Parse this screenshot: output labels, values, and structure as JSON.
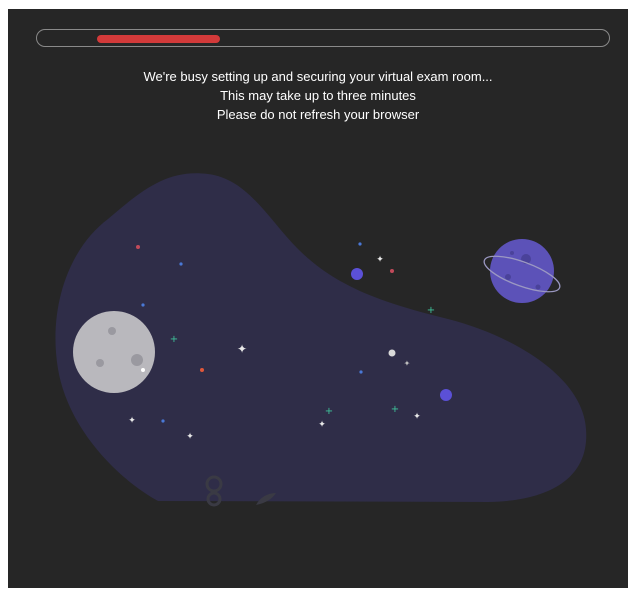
{
  "progress": {
    "fraction": 0.24,
    "track_color": "#8a8a8a",
    "fill_color": "#d33a3a"
  },
  "messages": [
    "We're busy setting up and securing your virtual exam room...",
    "This may take up to three minutes",
    "Please do not refresh your browser"
  ],
  "colors": {
    "background": "#262626",
    "blob": "#2f2d48",
    "moon": "#b9b8bd",
    "planet": "#5c52b8"
  },
  "illustration": {
    "icons": [
      "blob-shape",
      "moon-icon",
      "planet-icon",
      "stars-icon",
      "person-icon",
      "leaf-icon"
    ]
  }
}
